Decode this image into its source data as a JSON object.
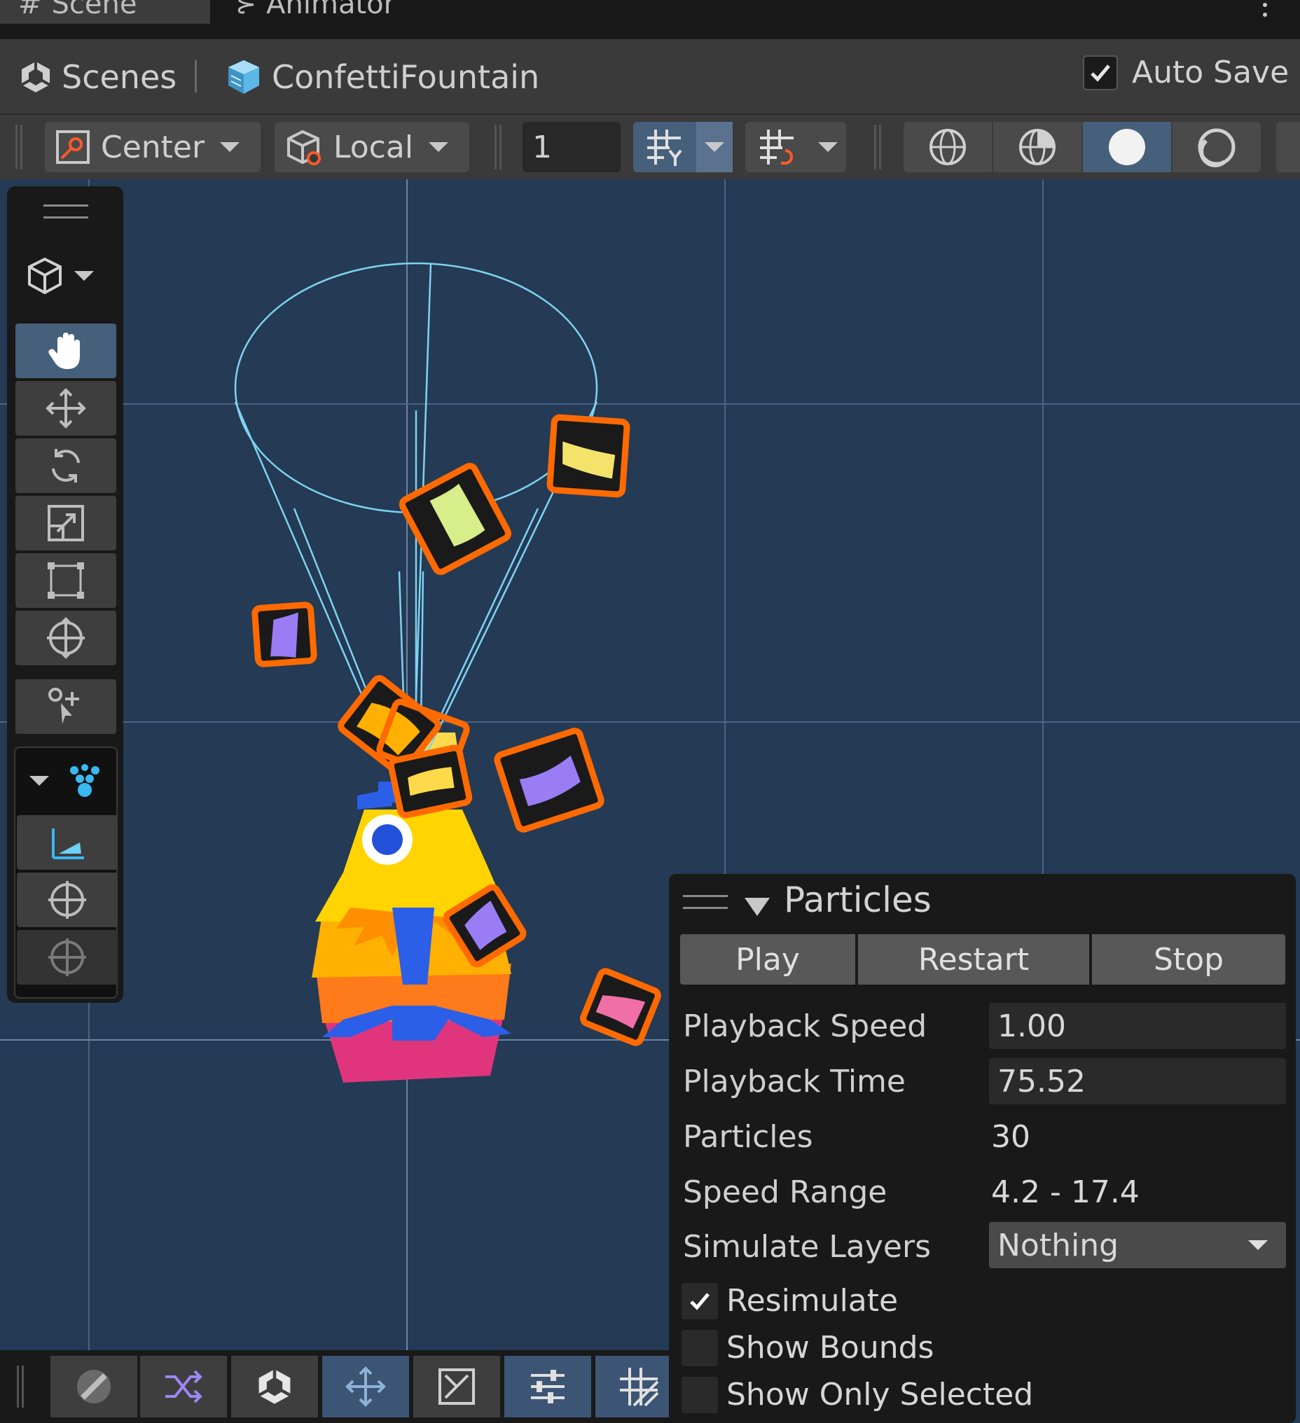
{
  "tabs": [
    {
      "label": "Scene",
      "icon": "hash-icon",
      "active": true
    },
    {
      "label": "Animator",
      "icon": "animator-icon",
      "active": false
    }
  ],
  "breadcrumb": {
    "root": "Scenes",
    "scene": "ConfettiFountain"
  },
  "autosave": {
    "label": "Auto Save",
    "checked": true
  },
  "toolbar": {
    "pivot": "Center",
    "space": "Local",
    "grid_value": "1"
  },
  "overlay": {
    "title": "Particles",
    "buttons": {
      "play": "Play",
      "restart": "Restart",
      "stop": "Stop"
    },
    "playback_speed": {
      "label": "Playback Speed",
      "value": "1.00"
    },
    "playback_time": {
      "label": "Playback Time",
      "value": "75.52"
    },
    "particles": {
      "label": "Particles",
      "value": "30"
    },
    "speed_range": {
      "label": "Speed Range",
      "value": "4.2 - 17.4"
    },
    "simulate_layers": {
      "label": "Simulate Layers",
      "value": "Nothing"
    },
    "resimulate": {
      "label": "Resimulate",
      "checked": true
    },
    "show_bounds": {
      "label": "Show Bounds",
      "checked": false
    },
    "show_only_selected": {
      "label": "Show Only Selected",
      "checked": false
    }
  },
  "colors": {
    "scene_bg": "#243a55",
    "selection": "#ff6a00",
    "gizmo": "#7fd3f0",
    "active_button": "#46607c"
  }
}
